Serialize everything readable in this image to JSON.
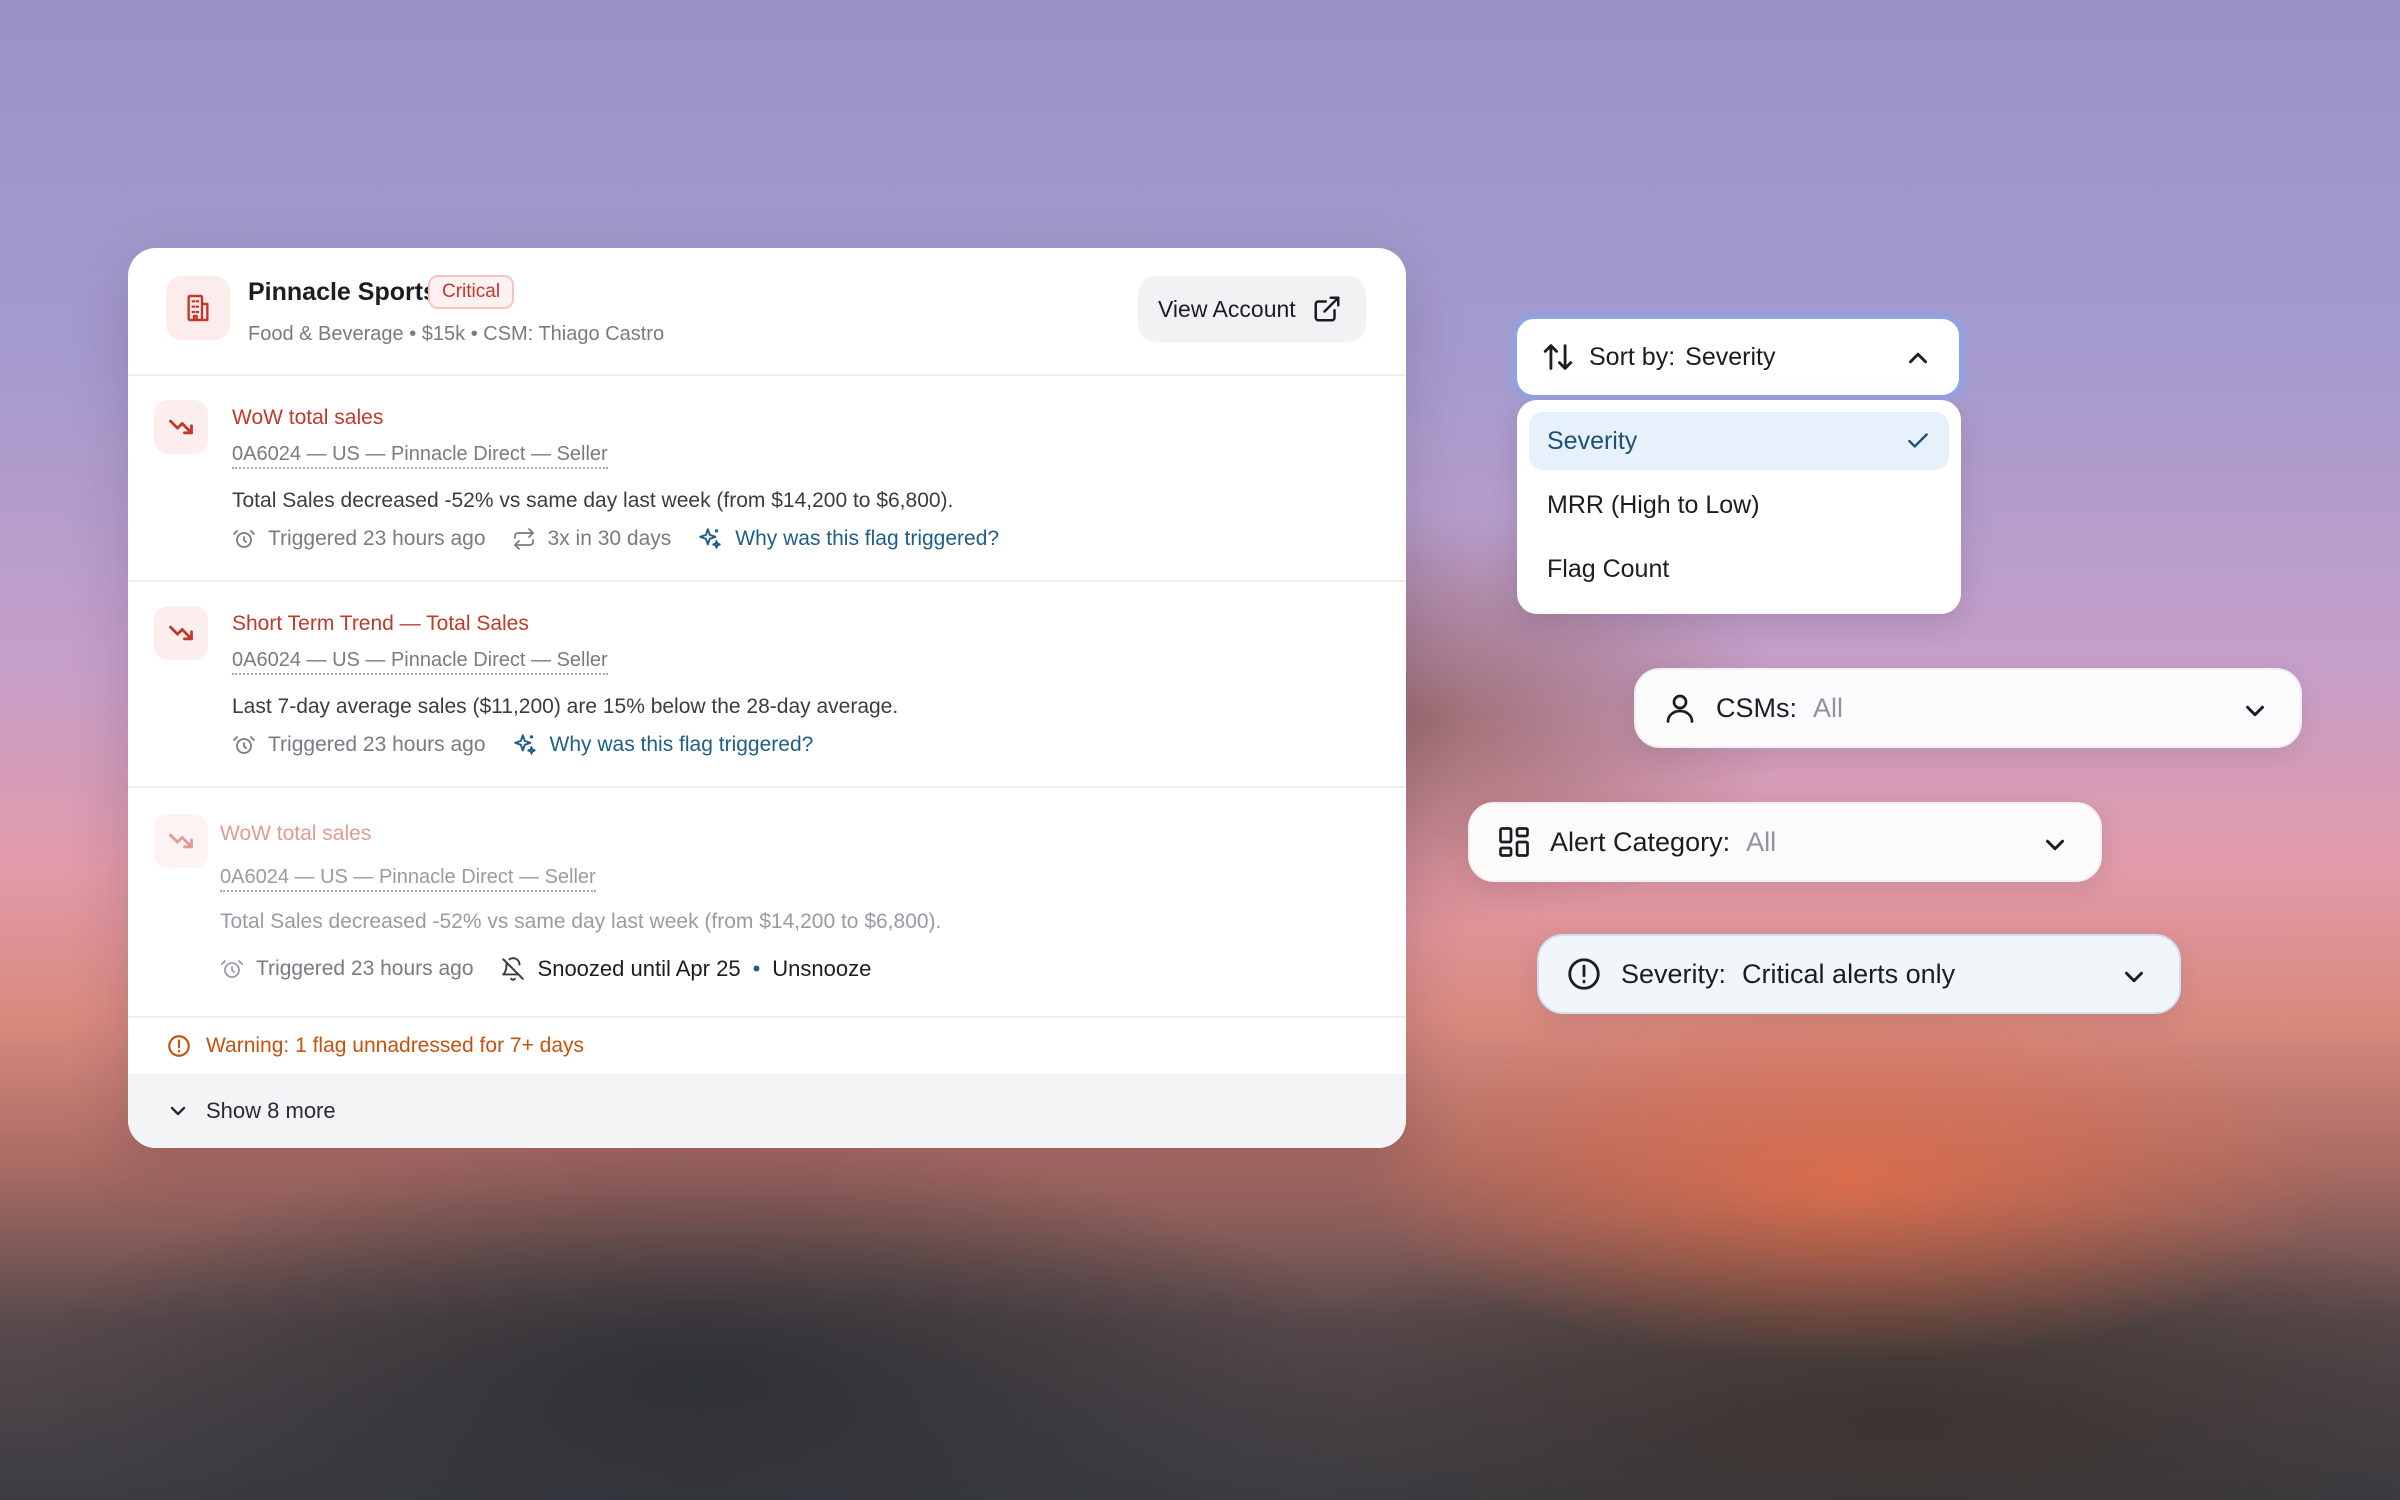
{
  "account": {
    "name": "Pinnacle Sports",
    "badge": "Critical",
    "meta": "Food & Beverage • $15k • CSM: Thiago Castro",
    "view_button": "View Account"
  },
  "flags": [
    {
      "title": "WoW total sales",
      "source": "0A6024 — US — Pinnacle Direct — Seller",
      "description": "Total Sales decreased -52% vs same day last week (from $14,200 to $6,800).",
      "triggered": "Triggered 23 hours ago",
      "frequency": "3x in 30 days",
      "why_link": "Why was this flag triggered?"
    },
    {
      "title": "Short Term Trend — Total Sales",
      "source": "0A6024 — US — Pinnacle Direct — Seller",
      "description": "Last 7-day average sales ($11,200) are 15% below the 28-day average.",
      "triggered": "Triggered 23 hours ago",
      "why_link": "Why was this flag triggered?"
    },
    {
      "title": "WoW total sales",
      "source": "0A6024 — US — Pinnacle Direct — Seller",
      "description": "Total Sales decreased -52% vs same day last week (from $14,200 to $6,800).",
      "triggered": "Triggered 23 hours ago",
      "snoozed": "Snoozed until Apr 25",
      "unsnooze": "Unsnooze"
    }
  ],
  "warning": "Warning: 1 flag unnadressed for 7+ days",
  "show_more": "Show 8 more",
  "sort": {
    "label": "Sort by:",
    "value": "Severity",
    "options": [
      "Severity",
      "MRR (High to Low)",
      "Flag Count"
    ],
    "selected": "Severity"
  },
  "filters": {
    "csms": {
      "label": "CSMs:",
      "value": "All"
    },
    "category": {
      "label": "Alert Category:",
      "value": "All"
    },
    "severity": {
      "label": "Severity:",
      "value": "Critical alerts only"
    }
  },
  "colors": {
    "critical": "#c0392b",
    "link": "#1f5e86",
    "warning": "#c4530d",
    "selected_bg": "#e6f1fb"
  }
}
